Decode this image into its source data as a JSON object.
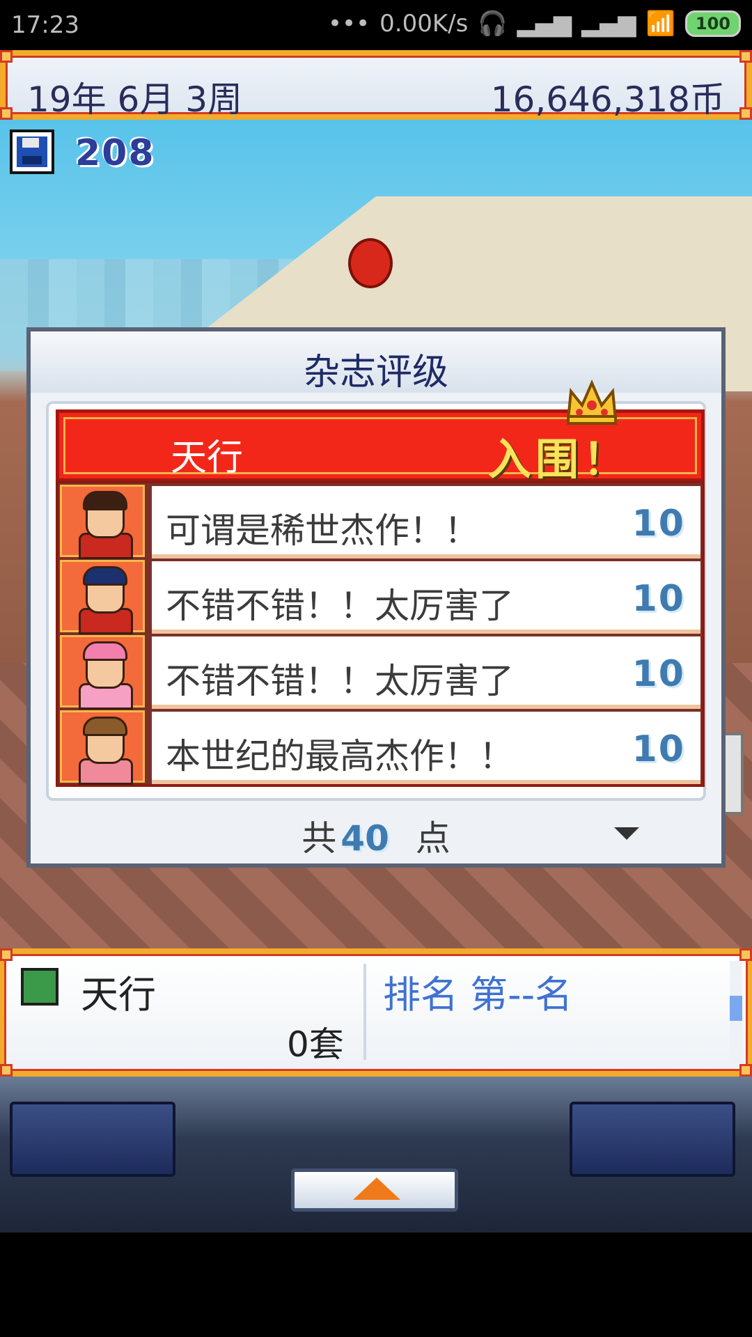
{
  "status_bar": {
    "time": "17:23",
    "network_speed": "0.00K/s",
    "battery": "100"
  },
  "top_bar": {
    "date": "19年 6月 3周",
    "money": "16,646,318币"
  },
  "save": {
    "count": "208",
    "icon": "floppy-disk-icon"
  },
  "dialog": {
    "title": "杂志评级",
    "game_name": "天行",
    "result_tag": "入围！",
    "reviews": [
      {
        "comment": "可谓是稀世杰作！！",
        "score": "10",
        "hair": "#3a1f12",
        "shirt": "#c9291e"
      },
      {
        "comment": "不错不错！！太厉害了",
        "score": "10",
        "hair": "#1c2f6e",
        "shirt": "#c9291e"
      },
      {
        "comment": "不错不错！！太厉害了",
        "score": "10",
        "hair": "#f27fae",
        "shirt": "#f6a0c3"
      },
      {
        "comment": "本世纪的最高杰作！！",
        "score": "10",
        "hair": "#8a5a2a",
        "shirt": "#f08a9b"
      }
    ],
    "total_prefix": "共",
    "total_points": "40",
    "total_suffix": "点"
  },
  "info_bar": {
    "name": "天行",
    "copies": "0套",
    "rank": "排名 第--名"
  },
  "colors": {
    "banner_red": "#f2271a",
    "score_blue": "#3f7bb0",
    "frame_orange": "#f2ab2b"
  }
}
